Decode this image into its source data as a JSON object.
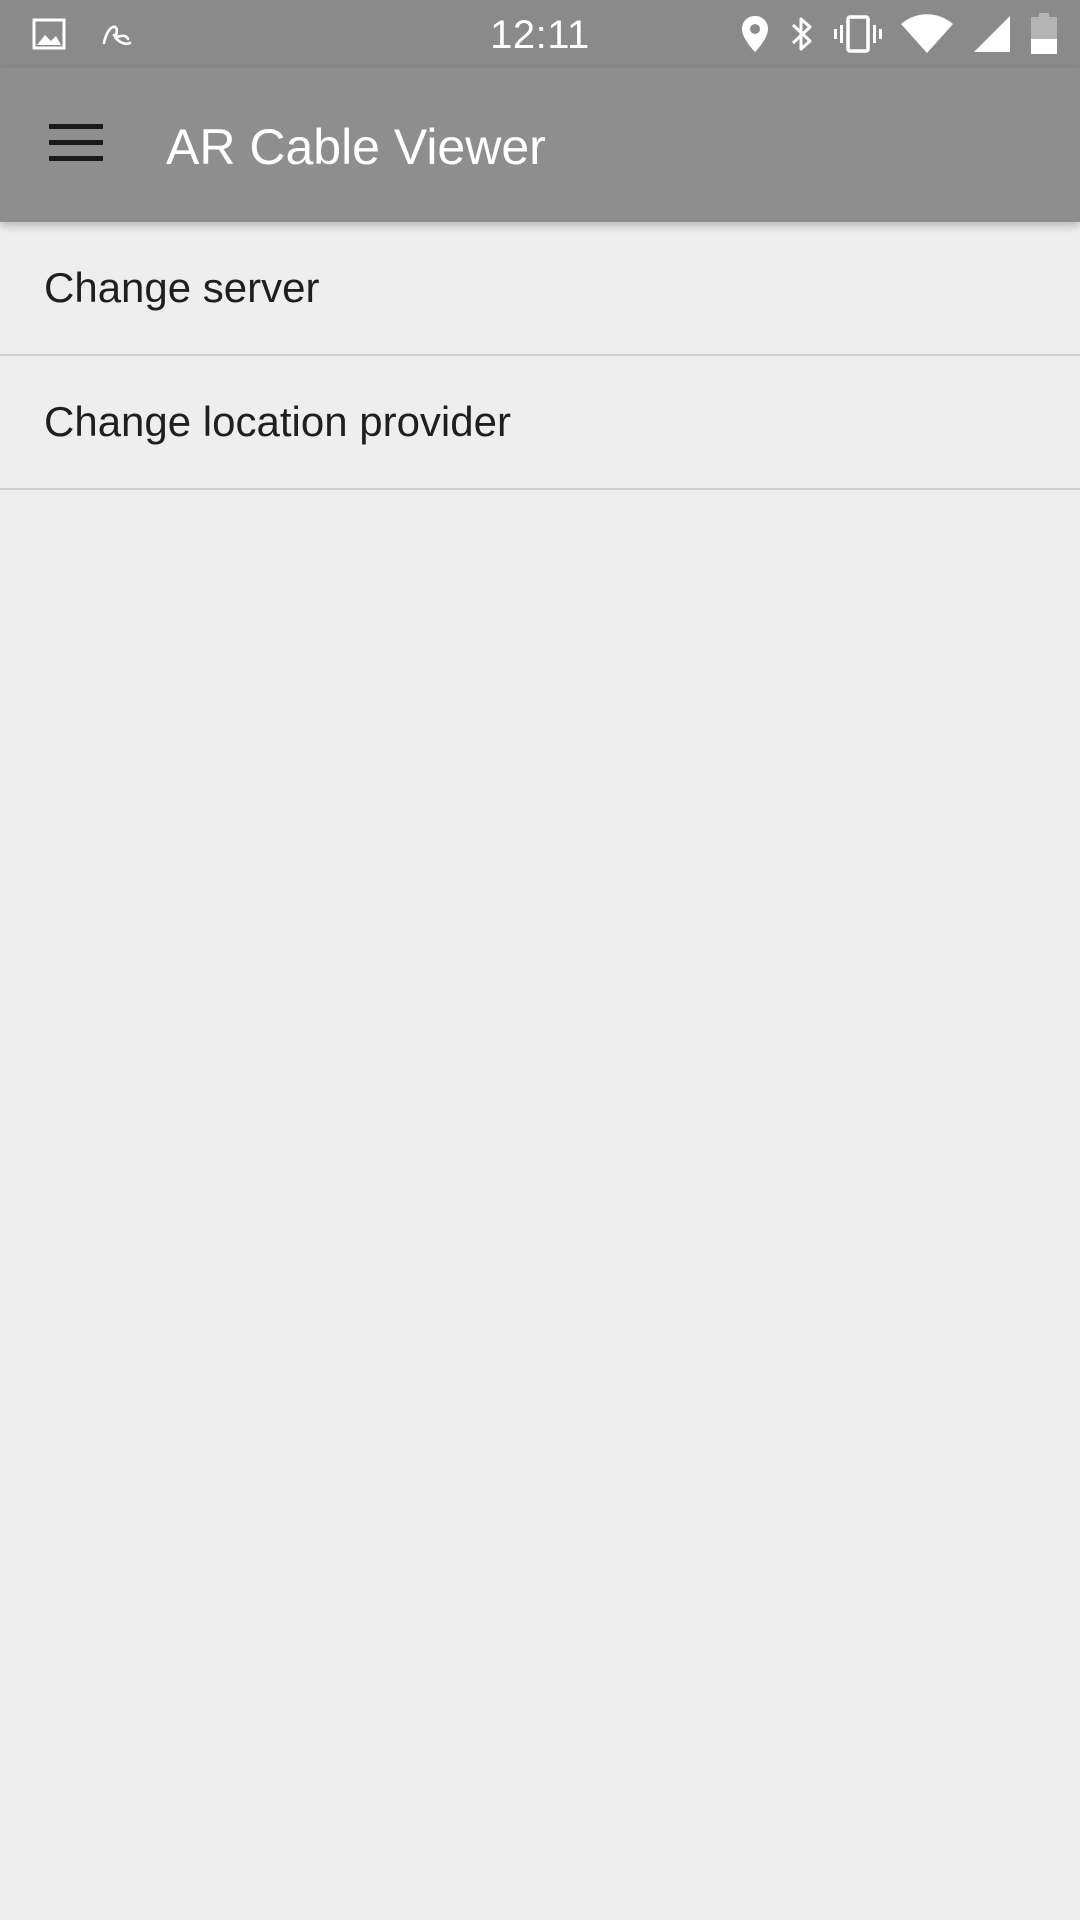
{
  "status_bar": {
    "time": "12:11",
    "left_icons": [
      "image-notification-icon",
      "app-notification-icon"
    ],
    "right_icons": [
      "location-icon",
      "bluetooth-icon",
      "vibrate-icon",
      "wifi-icon",
      "cellular-signal-icon",
      "battery-icon"
    ]
  },
  "app_bar": {
    "title": "AR Cable Viewer",
    "menu_icon": "hamburger-menu-icon"
  },
  "settings": {
    "items": [
      {
        "label": "Change server"
      },
      {
        "label": "Change location provider"
      }
    ]
  },
  "colors": {
    "status_bar": "#8a8a8a",
    "app_bar": "#8e8e8e",
    "background": "#eeeeee",
    "divider": "#cfcfcf",
    "text_primary": "#1f1f1f"
  }
}
